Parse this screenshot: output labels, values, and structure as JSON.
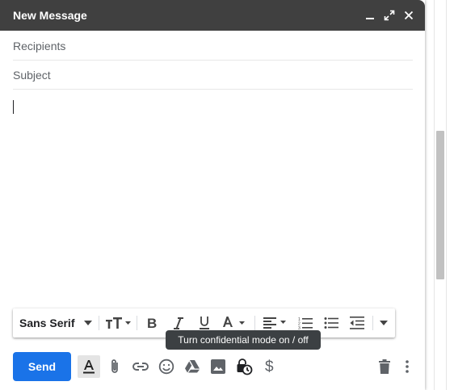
{
  "window": {
    "title": "New Message",
    "icons": [
      "minimize-icon",
      "expand-icon",
      "close-icon"
    ]
  },
  "fields": {
    "recipients_placeholder": "Recipients",
    "subject_placeholder": "Subject",
    "body": ""
  },
  "formatting": {
    "font_family": "Sans Serif",
    "icons": [
      "font-size-icon",
      "bold-icon",
      "italic-icon",
      "underline-icon",
      "text-color-icon",
      "align-icon",
      "numbered-list-icon",
      "bulleted-list-icon",
      "indent-less-icon",
      "more-formatting-icon"
    ]
  },
  "tooltip": "Turn confidential mode on / off",
  "actions": {
    "send_label": "Send",
    "icons": [
      "formatting-options-icon",
      "attach-icon",
      "link-icon",
      "emoji-icon",
      "drive-icon",
      "photo-icon",
      "confidential-mode-icon",
      "dollar-icon",
      "trash-icon",
      "more-options-icon"
    ]
  },
  "colors": {
    "titlebar": "#404040",
    "send_button": "#1a73e8",
    "tooltip": "#3c4043"
  }
}
